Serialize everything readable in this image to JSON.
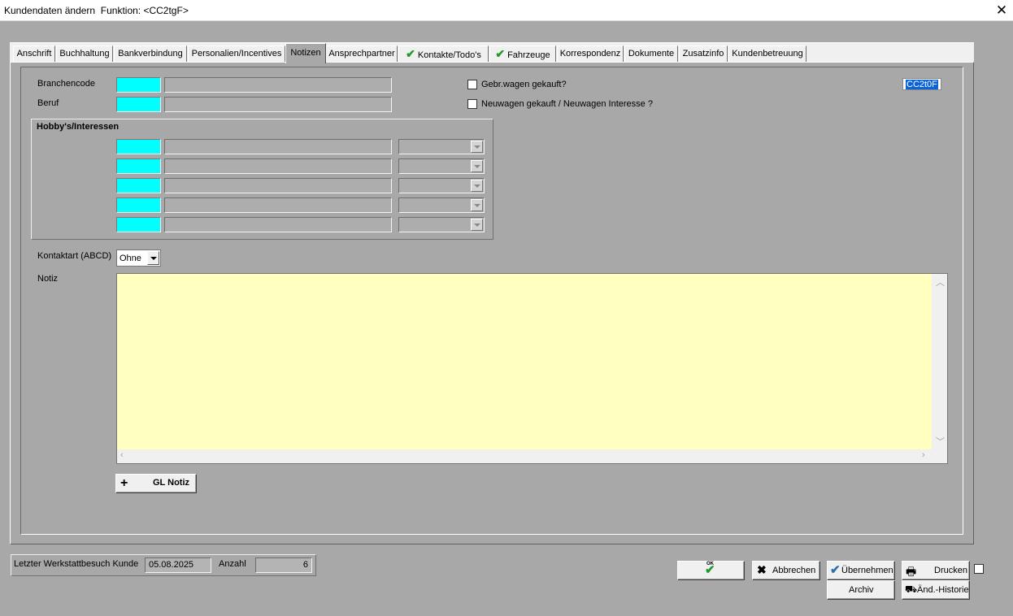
{
  "window": {
    "title": "Kundendaten ändern  Funktion: <CC2tgF>",
    "close_glyph": "✕"
  },
  "tabs": [
    {
      "label": "Anschrift",
      "active": false,
      "checked": false
    },
    {
      "label": "Buchhaltung",
      "active": false,
      "checked": false
    },
    {
      "label": "Bankverbindung",
      "active": false,
      "checked": false
    },
    {
      "label": "Personalien/Incentives",
      "active": false,
      "checked": false
    },
    {
      "label": "Notizen",
      "active": true,
      "checked": false
    },
    {
      "label": "Ansprechpartner",
      "active": false,
      "checked": false
    },
    {
      "label": "Kontakte/Todo's",
      "active": false,
      "checked": true
    },
    {
      "label": "Fahrzeuge",
      "active": false,
      "checked": true
    },
    {
      "label": "Korrespondenz",
      "active": false,
      "checked": false
    },
    {
      "label": "Dokumente",
      "active": false,
      "checked": false
    },
    {
      "label": "Zusatzinfo",
      "active": false,
      "checked": false
    },
    {
      "label": "Kundenbetreuung",
      "active": false,
      "checked": false
    }
  ],
  "form": {
    "branchencode_label": "Branchencode",
    "beruf_label": "Beruf",
    "gebrauchtwagen_label": "Gebr.wagen gekauft?",
    "gebrauchtwagen_checked": false,
    "neuwagen_label": "Neuwagen gekauft / Neuwagen Interesse ?",
    "neuwagen_checked": false,
    "code_value": "CC2t0F",
    "hobbies_title": "Hobby's/Interessen",
    "hobby_rows": 5,
    "kontaktart_label": "Kontaktart (ABCD)",
    "kontaktart_value": "Ohne",
    "notiz_label": "Notiz",
    "notiz_text": "",
    "gl_notiz_button": "GL Notiz",
    "gl_notiz_icon": "+"
  },
  "footer": {
    "werkstatt_label": "Letzter Werkstattbesuch Kunde",
    "werkstatt_date": "05.08.2025",
    "anzahl_label": "Anzahl",
    "anzahl_value": "6",
    "ok_label": "OK",
    "abbrechen_label": "Abbrechen",
    "uebernehmen_label": "Übernehmen",
    "drucken_label": "Drucken",
    "archiv_label": "Archiv",
    "historie_label": "Änd.-Historie"
  },
  "colors": {
    "background": "#a8a8a8",
    "input_cyan": "#00ffff",
    "notiz_yellow": "#ffffc0",
    "check_green": "#1e9a28"
  }
}
